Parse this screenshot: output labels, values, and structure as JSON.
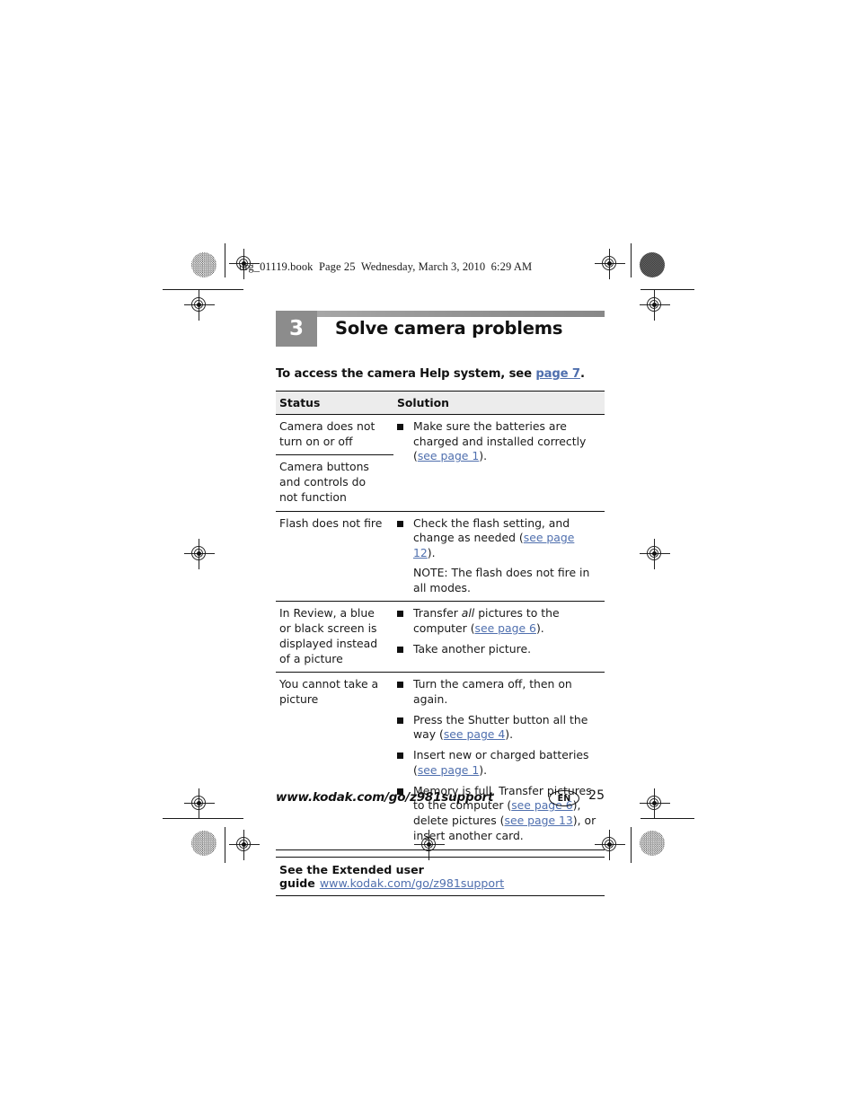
{
  "slug": "urg_01119.book  Page 25  Wednesday, March 3, 2010  6:29 AM",
  "chapter": {
    "number": "3",
    "title": "Solve camera problems"
  },
  "intro": {
    "text_before": "To access the camera Help system, see ",
    "link": "page 7",
    "text_after": "."
  },
  "table": {
    "headers": {
      "status": "Status",
      "solution": "Solution"
    },
    "rows": [
      {
        "status": "Camera does not turn on or off",
        "status2": "Camera buttons and controls do not function",
        "bullets": [
          {
            "parts": [
              {
                "t": "Make sure the batteries are charged and installed correctly (",
                "k": "text"
              },
              {
                "t": "see page 1",
                "k": "link"
              },
              {
                "t": ").",
                "k": "text"
              }
            ]
          }
        ]
      },
      {
        "status": "Flash does not fire",
        "bullets": [
          {
            "parts": [
              {
                "t": "Check the flash setting, and change as needed (",
                "k": "text"
              },
              {
                "t": "see page 12",
                "k": "link"
              },
              {
                "t": ").",
                "k": "text"
              }
            ]
          }
        ],
        "note": "NOTE:  The flash does not fire in all modes."
      },
      {
        "status": "In Review, a blue or black screen is displayed instead of a picture",
        "bullets": [
          {
            "parts": [
              {
                "t": "Transfer ",
                "k": "text"
              },
              {
                "t": "all",
                "k": "italic"
              },
              {
                "t": " pictures to the computer (",
                "k": "text"
              },
              {
                "t": "see page 6",
                "k": "link"
              },
              {
                "t": ").",
                "k": "text"
              }
            ]
          },
          {
            "parts": [
              {
                "t": "Take another picture.",
                "k": "text"
              }
            ]
          }
        ]
      },
      {
        "status": "You cannot take a picture",
        "bullets": [
          {
            "parts": [
              {
                "t": "Turn the camera off, then on again.",
                "k": "text"
              }
            ]
          },
          {
            "parts": [
              {
                "t": "Press the Shutter button all the way (",
                "k": "text"
              },
              {
                "t": "see page 4",
                "k": "link"
              },
              {
                "t": ").",
                "k": "text"
              }
            ]
          },
          {
            "parts": [
              {
                "t": "Insert new or charged batteries (",
                "k": "text"
              },
              {
                "t": "see page 1",
                "k": "link"
              },
              {
                "t": ").",
                "k": "text"
              }
            ]
          },
          {
            "parts": [
              {
                "t": "Memory is full. Transfer pictures to the computer (",
                "k": "text"
              },
              {
                "t": "see page 6",
                "k": "link"
              },
              {
                "t": "), delete pictures (",
                "k": "text"
              },
              {
                "t": "see page 13",
                "k": "link"
              },
              {
                "t": "), or insert another card.",
                "k": "text"
              }
            ]
          }
        ]
      }
    ]
  },
  "guide": {
    "title": "See the Extended user guide",
    "url": "www.kodak.com/go/z981support"
  },
  "footer": {
    "url": "www.kodak.com/go/z981support",
    "language": "EN",
    "page_number": "25"
  },
  "colors": {
    "link": "#4f6fae",
    "chapter_box": "#8c8c8c",
    "header_row": "#ececec"
  }
}
